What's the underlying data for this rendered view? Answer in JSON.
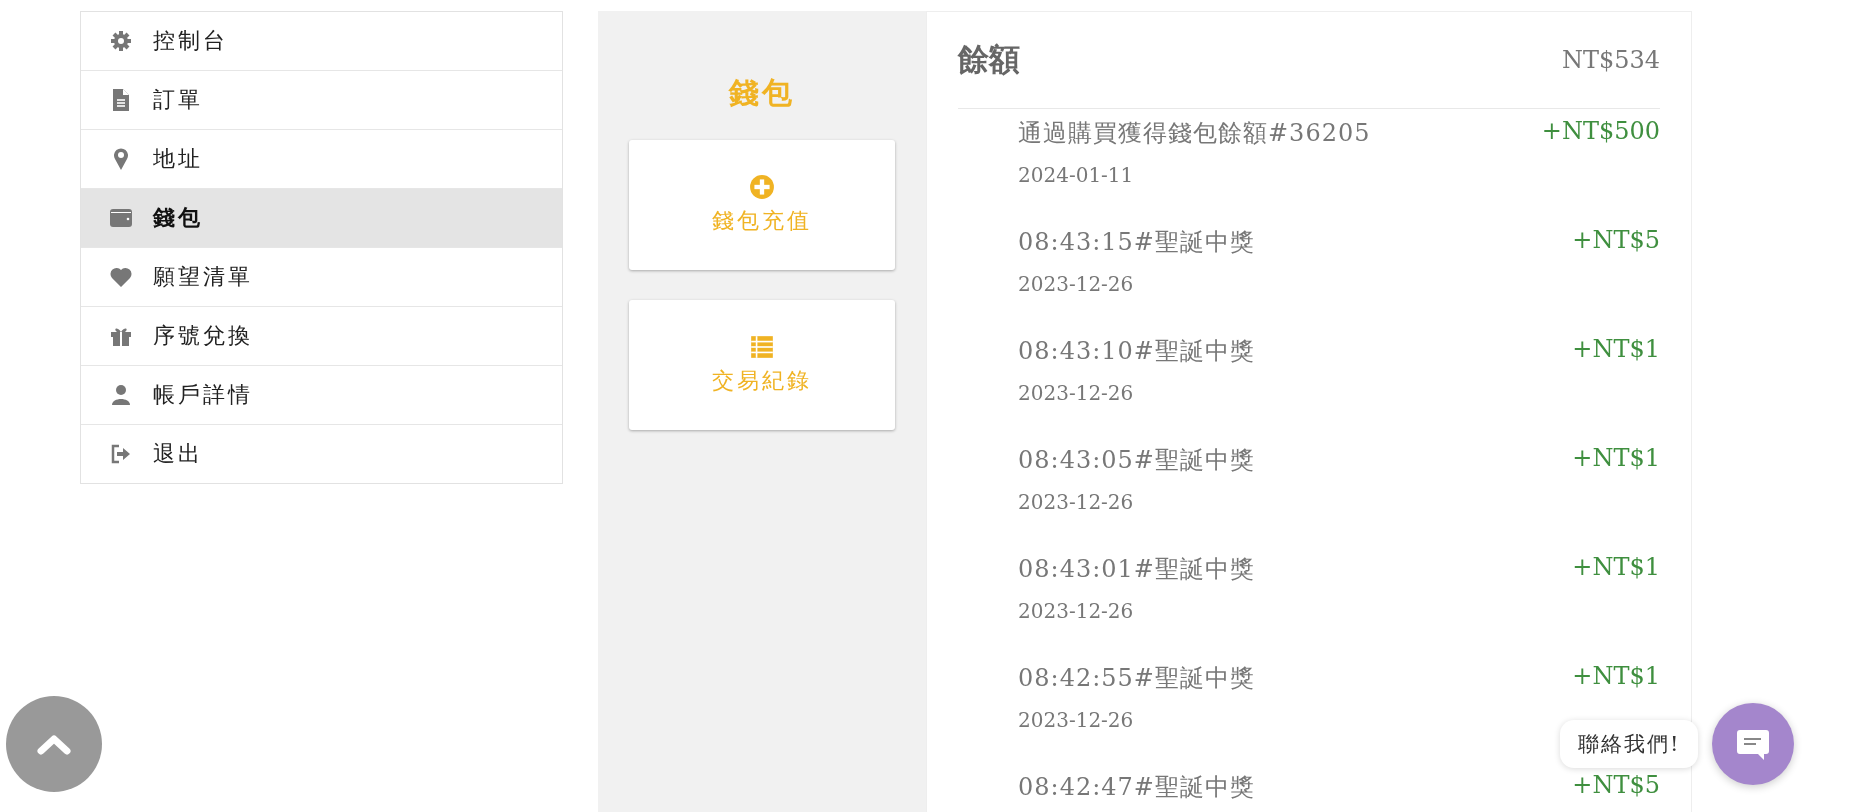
{
  "sidebar": {
    "items": [
      {
        "label": "控制台",
        "kind": "gear",
        "selected": false
      },
      {
        "label": "訂單",
        "kind": "document",
        "selected": false
      },
      {
        "label": "地址",
        "kind": "pin",
        "selected": false
      },
      {
        "label": "錢包",
        "kind": "wallet",
        "selected": true
      },
      {
        "label": "願望清單",
        "kind": "heart",
        "selected": false
      },
      {
        "label": "序號兌換",
        "kind": "gift",
        "selected": false
      },
      {
        "label": "帳戶詳情",
        "kind": "user",
        "selected": false
      },
      {
        "label": "退出",
        "kind": "logout",
        "selected": false
      }
    ]
  },
  "wallet": {
    "title": "錢包",
    "actions": [
      {
        "label": "錢包充值",
        "kind": "add"
      },
      {
        "label": "交易紀錄",
        "kind": "list"
      }
    ]
  },
  "balance": {
    "label": "餘額",
    "amount": "NT$534",
    "entries": [
      {
        "title": "通過購買獲得錢包餘額#36205",
        "amount": "+NT$500",
        "date": "2024-01-11"
      },
      {
        "title": "08:43:15#聖誕中獎",
        "amount": "+NT$5",
        "date": "2023-12-26"
      },
      {
        "title": "08:43:10#聖誕中獎",
        "amount": "+NT$1",
        "date": "2023-12-26"
      },
      {
        "title": "08:43:05#聖誕中獎",
        "amount": "+NT$1",
        "date": "2023-12-26"
      },
      {
        "title": "08:43:01#聖誕中獎",
        "amount": "+NT$1",
        "date": "2023-12-26"
      },
      {
        "title": "08:42:55#聖誕中獎",
        "amount": "+NT$1",
        "date": "2023-12-26"
      },
      {
        "title": "08:42:47#聖誕中獎",
        "amount": "+NT$5"
      }
    ]
  },
  "chat": {
    "label": "聯絡我們!"
  }
}
